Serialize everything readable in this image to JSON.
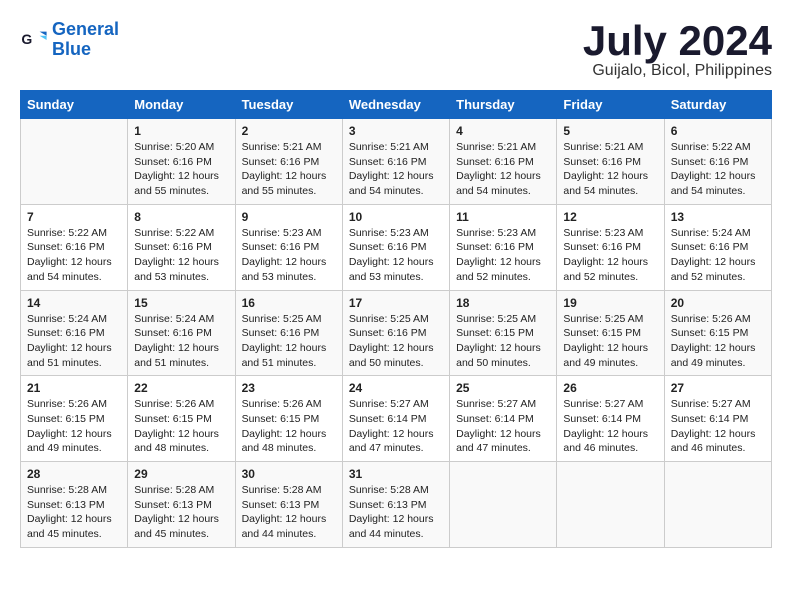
{
  "header": {
    "logo_line1": "General",
    "logo_line2": "Blue",
    "month": "July 2024",
    "location": "Guijalo, Bicol, Philippines"
  },
  "weekdays": [
    "Sunday",
    "Monday",
    "Tuesday",
    "Wednesday",
    "Thursday",
    "Friday",
    "Saturday"
  ],
  "weeks": [
    [
      {
        "day": "",
        "info": ""
      },
      {
        "day": "1",
        "info": "Sunrise: 5:20 AM\nSunset: 6:16 PM\nDaylight: 12 hours\nand 55 minutes."
      },
      {
        "day": "2",
        "info": "Sunrise: 5:21 AM\nSunset: 6:16 PM\nDaylight: 12 hours\nand 55 minutes."
      },
      {
        "day": "3",
        "info": "Sunrise: 5:21 AM\nSunset: 6:16 PM\nDaylight: 12 hours\nand 54 minutes."
      },
      {
        "day": "4",
        "info": "Sunrise: 5:21 AM\nSunset: 6:16 PM\nDaylight: 12 hours\nand 54 minutes."
      },
      {
        "day": "5",
        "info": "Sunrise: 5:21 AM\nSunset: 6:16 PM\nDaylight: 12 hours\nand 54 minutes."
      },
      {
        "day": "6",
        "info": "Sunrise: 5:22 AM\nSunset: 6:16 PM\nDaylight: 12 hours\nand 54 minutes."
      }
    ],
    [
      {
        "day": "7",
        "info": "Sunrise: 5:22 AM\nSunset: 6:16 PM\nDaylight: 12 hours\nand 54 minutes."
      },
      {
        "day": "8",
        "info": "Sunrise: 5:22 AM\nSunset: 6:16 PM\nDaylight: 12 hours\nand 53 minutes."
      },
      {
        "day": "9",
        "info": "Sunrise: 5:23 AM\nSunset: 6:16 PM\nDaylight: 12 hours\nand 53 minutes."
      },
      {
        "day": "10",
        "info": "Sunrise: 5:23 AM\nSunset: 6:16 PM\nDaylight: 12 hours\nand 53 minutes."
      },
      {
        "day": "11",
        "info": "Sunrise: 5:23 AM\nSunset: 6:16 PM\nDaylight: 12 hours\nand 52 minutes."
      },
      {
        "day": "12",
        "info": "Sunrise: 5:23 AM\nSunset: 6:16 PM\nDaylight: 12 hours\nand 52 minutes."
      },
      {
        "day": "13",
        "info": "Sunrise: 5:24 AM\nSunset: 6:16 PM\nDaylight: 12 hours\nand 52 minutes."
      }
    ],
    [
      {
        "day": "14",
        "info": "Sunrise: 5:24 AM\nSunset: 6:16 PM\nDaylight: 12 hours\nand 51 minutes."
      },
      {
        "day": "15",
        "info": "Sunrise: 5:24 AM\nSunset: 6:16 PM\nDaylight: 12 hours\nand 51 minutes."
      },
      {
        "day": "16",
        "info": "Sunrise: 5:25 AM\nSunset: 6:16 PM\nDaylight: 12 hours\nand 51 minutes."
      },
      {
        "day": "17",
        "info": "Sunrise: 5:25 AM\nSunset: 6:16 PM\nDaylight: 12 hours\nand 50 minutes."
      },
      {
        "day": "18",
        "info": "Sunrise: 5:25 AM\nSunset: 6:15 PM\nDaylight: 12 hours\nand 50 minutes."
      },
      {
        "day": "19",
        "info": "Sunrise: 5:25 AM\nSunset: 6:15 PM\nDaylight: 12 hours\nand 49 minutes."
      },
      {
        "day": "20",
        "info": "Sunrise: 5:26 AM\nSunset: 6:15 PM\nDaylight: 12 hours\nand 49 minutes."
      }
    ],
    [
      {
        "day": "21",
        "info": "Sunrise: 5:26 AM\nSunset: 6:15 PM\nDaylight: 12 hours\nand 49 minutes."
      },
      {
        "day": "22",
        "info": "Sunrise: 5:26 AM\nSunset: 6:15 PM\nDaylight: 12 hours\nand 48 minutes."
      },
      {
        "day": "23",
        "info": "Sunrise: 5:26 AM\nSunset: 6:15 PM\nDaylight: 12 hours\nand 48 minutes."
      },
      {
        "day": "24",
        "info": "Sunrise: 5:27 AM\nSunset: 6:14 PM\nDaylight: 12 hours\nand 47 minutes."
      },
      {
        "day": "25",
        "info": "Sunrise: 5:27 AM\nSunset: 6:14 PM\nDaylight: 12 hours\nand 47 minutes."
      },
      {
        "day": "26",
        "info": "Sunrise: 5:27 AM\nSunset: 6:14 PM\nDaylight: 12 hours\nand 46 minutes."
      },
      {
        "day": "27",
        "info": "Sunrise: 5:27 AM\nSunset: 6:14 PM\nDaylight: 12 hours\nand 46 minutes."
      }
    ],
    [
      {
        "day": "28",
        "info": "Sunrise: 5:28 AM\nSunset: 6:13 PM\nDaylight: 12 hours\nand 45 minutes."
      },
      {
        "day": "29",
        "info": "Sunrise: 5:28 AM\nSunset: 6:13 PM\nDaylight: 12 hours\nand 45 minutes."
      },
      {
        "day": "30",
        "info": "Sunrise: 5:28 AM\nSunset: 6:13 PM\nDaylight: 12 hours\nand 44 minutes."
      },
      {
        "day": "31",
        "info": "Sunrise: 5:28 AM\nSunset: 6:13 PM\nDaylight: 12 hours\nand 44 minutes."
      },
      {
        "day": "",
        "info": ""
      },
      {
        "day": "",
        "info": ""
      },
      {
        "day": "",
        "info": ""
      }
    ]
  ]
}
